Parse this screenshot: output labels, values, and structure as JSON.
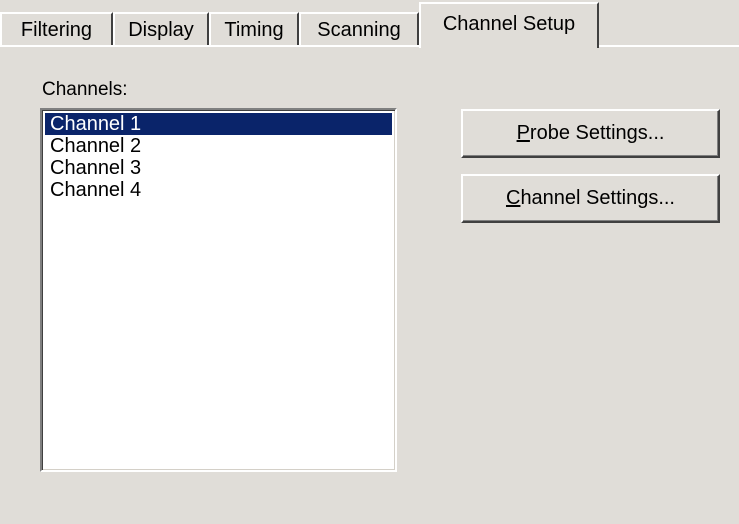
{
  "tabs": [
    {
      "label": "Filtering",
      "active": false
    },
    {
      "label": "Display",
      "active": false
    },
    {
      "label": "Timing",
      "active": false
    },
    {
      "label": "Scanning",
      "active": false
    },
    {
      "label": "Channel Setup",
      "active": true
    }
  ],
  "channels": {
    "label": "Channels:",
    "items": [
      "Channel 1",
      "Channel 2",
      "Channel 3",
      "Channel 4"
    ],
    "selected_index": 0
  },
  "buttons": {
    "probe": {
      "mnemonic": "P",
      "rest": "robe Settings..."
    },
    "channel": {
      "mnemonic": "C",
      "rest": "hannel Settings..."
    }
  },
  "colors": {
    "face": "#e0ddd8",
    "selection": "#0a246a",
    "selection_text": "#ffffff"
  }
}
